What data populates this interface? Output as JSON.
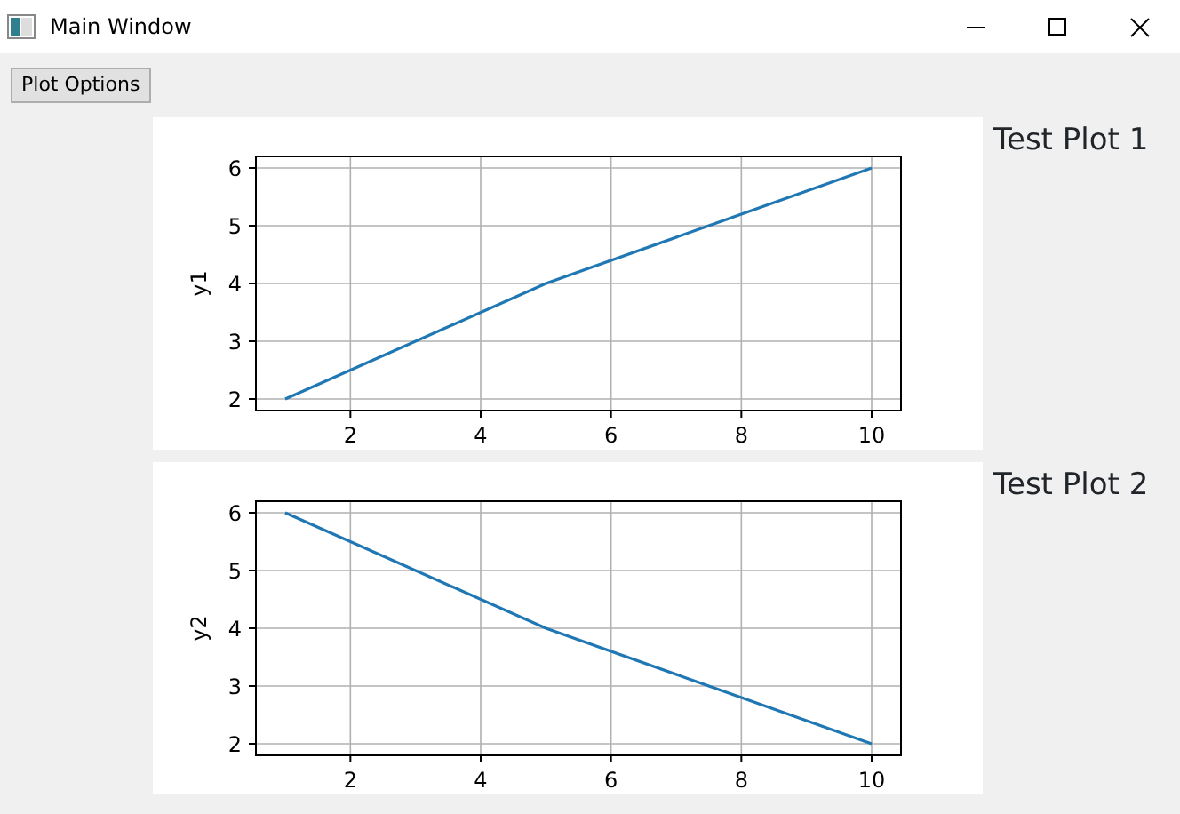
{
  "window": {
    "title": "Main Window"
  },
  "toolbar": {
    "button": "Plot Options"
  },
  "plots": [
    {
      "title": "Test Plot 1",
      "chart_data": {
        "type": "line",
        "ylabel": "y1",
        "x": [
          1,
          5,
          10
        ],
        "series": [
          {
            "color": "#1f77b4",
            "values": [
              2,
              4,
              6
            ]
          }
        ],
        "grid": true,
        "xlim": [
          0.55,
          10.45
        ],
        "ylim": [
          1.8,
          6.2
        ],
        "xticks": [
          2,
          4,
          6,
          8,
          10
        ],
        "yticks": [
          2,
          3,
          4,
          5,
          6
        ]
      }
    },
    {
      "title": "Test Plot 2",
      "chart_data": {
        "type": "line",
        "ylabel": "y2",
        "x": [
          1,
          5,
          10
        ],
        "series": [
          {
            "color": "#1f77b4",
            "values": [
              6,
              4,
              2
            ]
          }
        ],
        "grid": true,
        "xlim": [
          0.55,
          10.45
        ],
        "ylim": [
          1.8,
          6.2
        ],
        "xticks": [
          2,
          4,
          6,
          8,
          10
        ],
        "yticks": [
          2,
          3,
          4,
          5,
          6
        ]
      }
    }
  ]
}
